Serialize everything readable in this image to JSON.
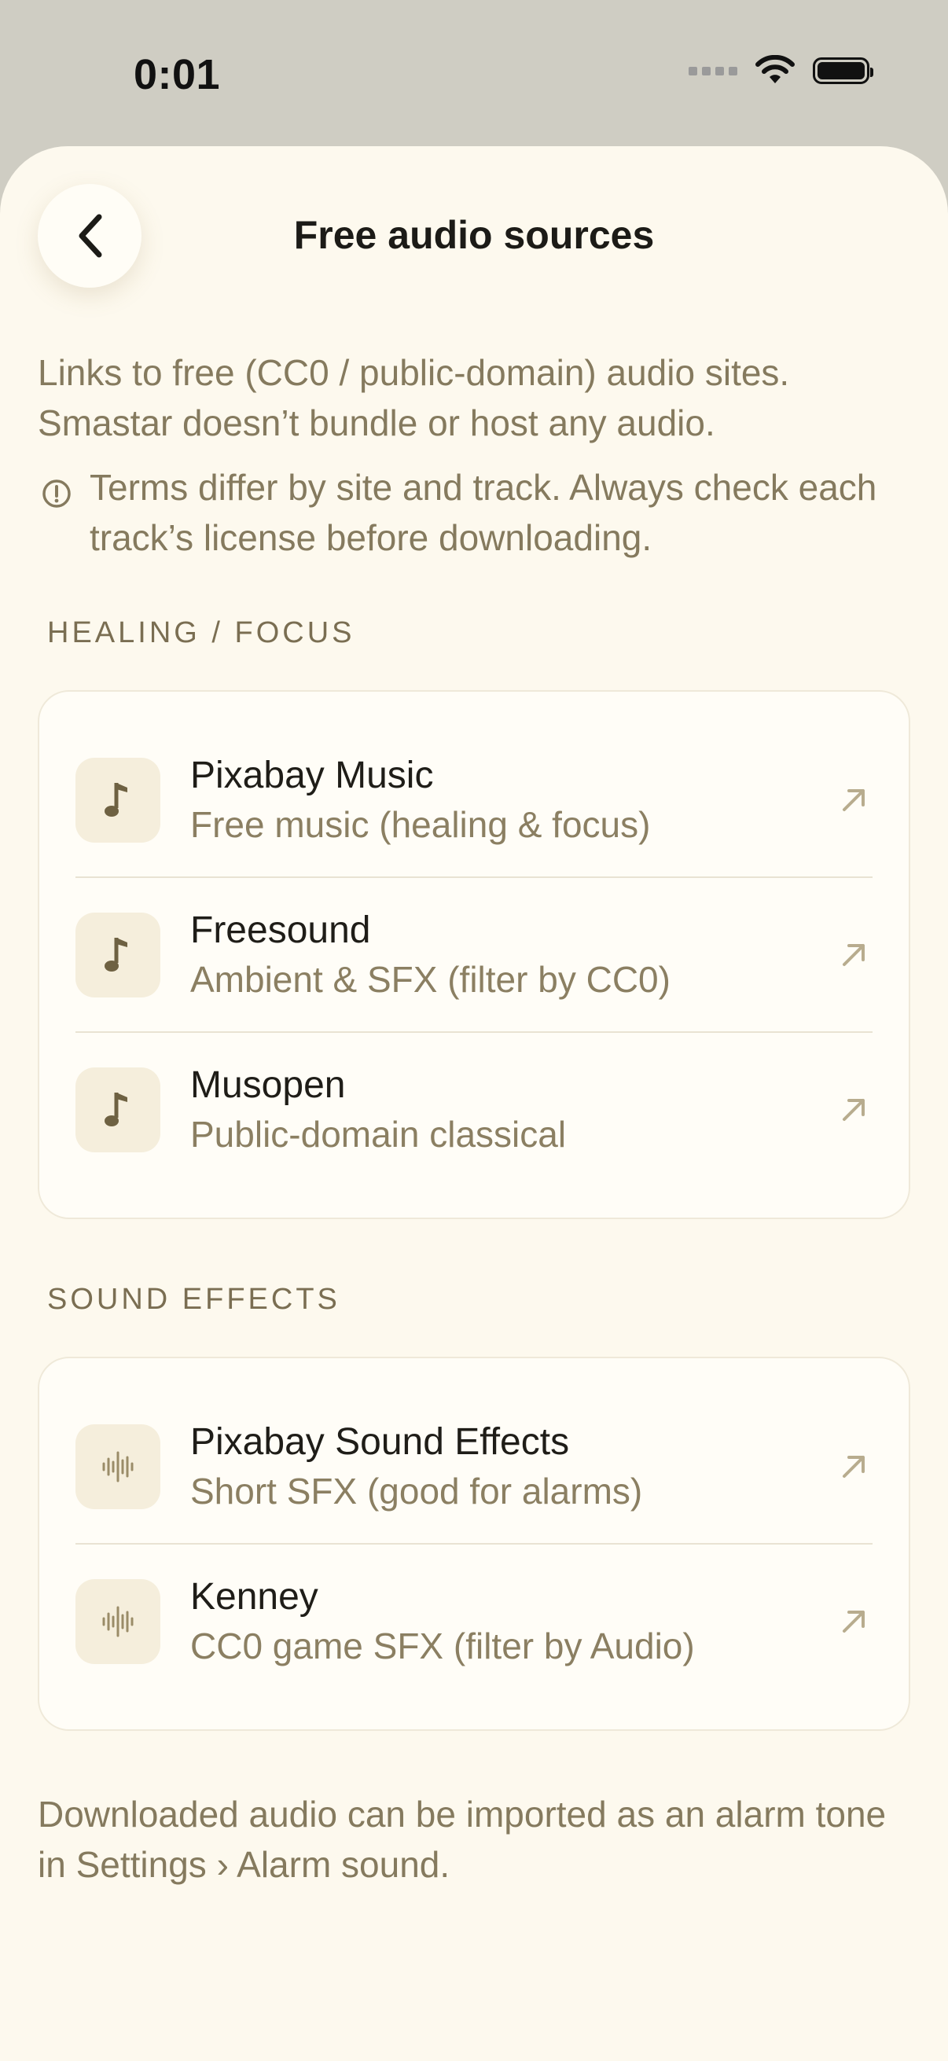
{
  "status_bar": {
    "time": "0:01"
  },
  "header": {
    "title": "Free audio sources"
  },
  "intro": {
    "description": "Links to free (CC0 / public-domain) audio sites. Smastar doesn’t bundle or host any audio.",
    "warning": "Terms differ by site and track. Always check each track’s license before downloading."
  },
  "sections": [
    {
      "label": "HEALING / FOCUS",
      "items": [
        {
          "title": "Pixabay Music",
          "subtitle": "Free music (healing & focus)",
          "icon": "music-note-icon"
        },
        {
          "title": "Freesound",
          "subtitle": "Ambient & SFX (filter by CC0)",
          "icon": "music-note-icon"
        },
        {
          "title": "Musopen",
          "subtitle": "Public-domain classical",
          "icon": "music-note-icon"
        }
      ]
    },
    {
      "label": "SOUND EFFECTS",
      "items": [
        {
          "title": "Pixabay Sound Effects",
          "subtitle": "Short SFX (good for alarms)",
          "icon": "waveform-icon"
        },
        {
          "title": "Kenney",
          "subtitle": "CC0 game SFX (filter by Audio)",
          "icon": "waveform-icon"
        }
      ]
    }
  ],
  "footer": {
    "note": "Downloaded audio can be imported as an alarm tone in Settings › Alarm sound."
  },
  "colors": {
    "sheet_bg": "#fdf9ee",
    "muted_text": "#857a5e",
    "icon_tile": "#f5eedc",
    "accent_icon": "#6e6142"
  }
}
